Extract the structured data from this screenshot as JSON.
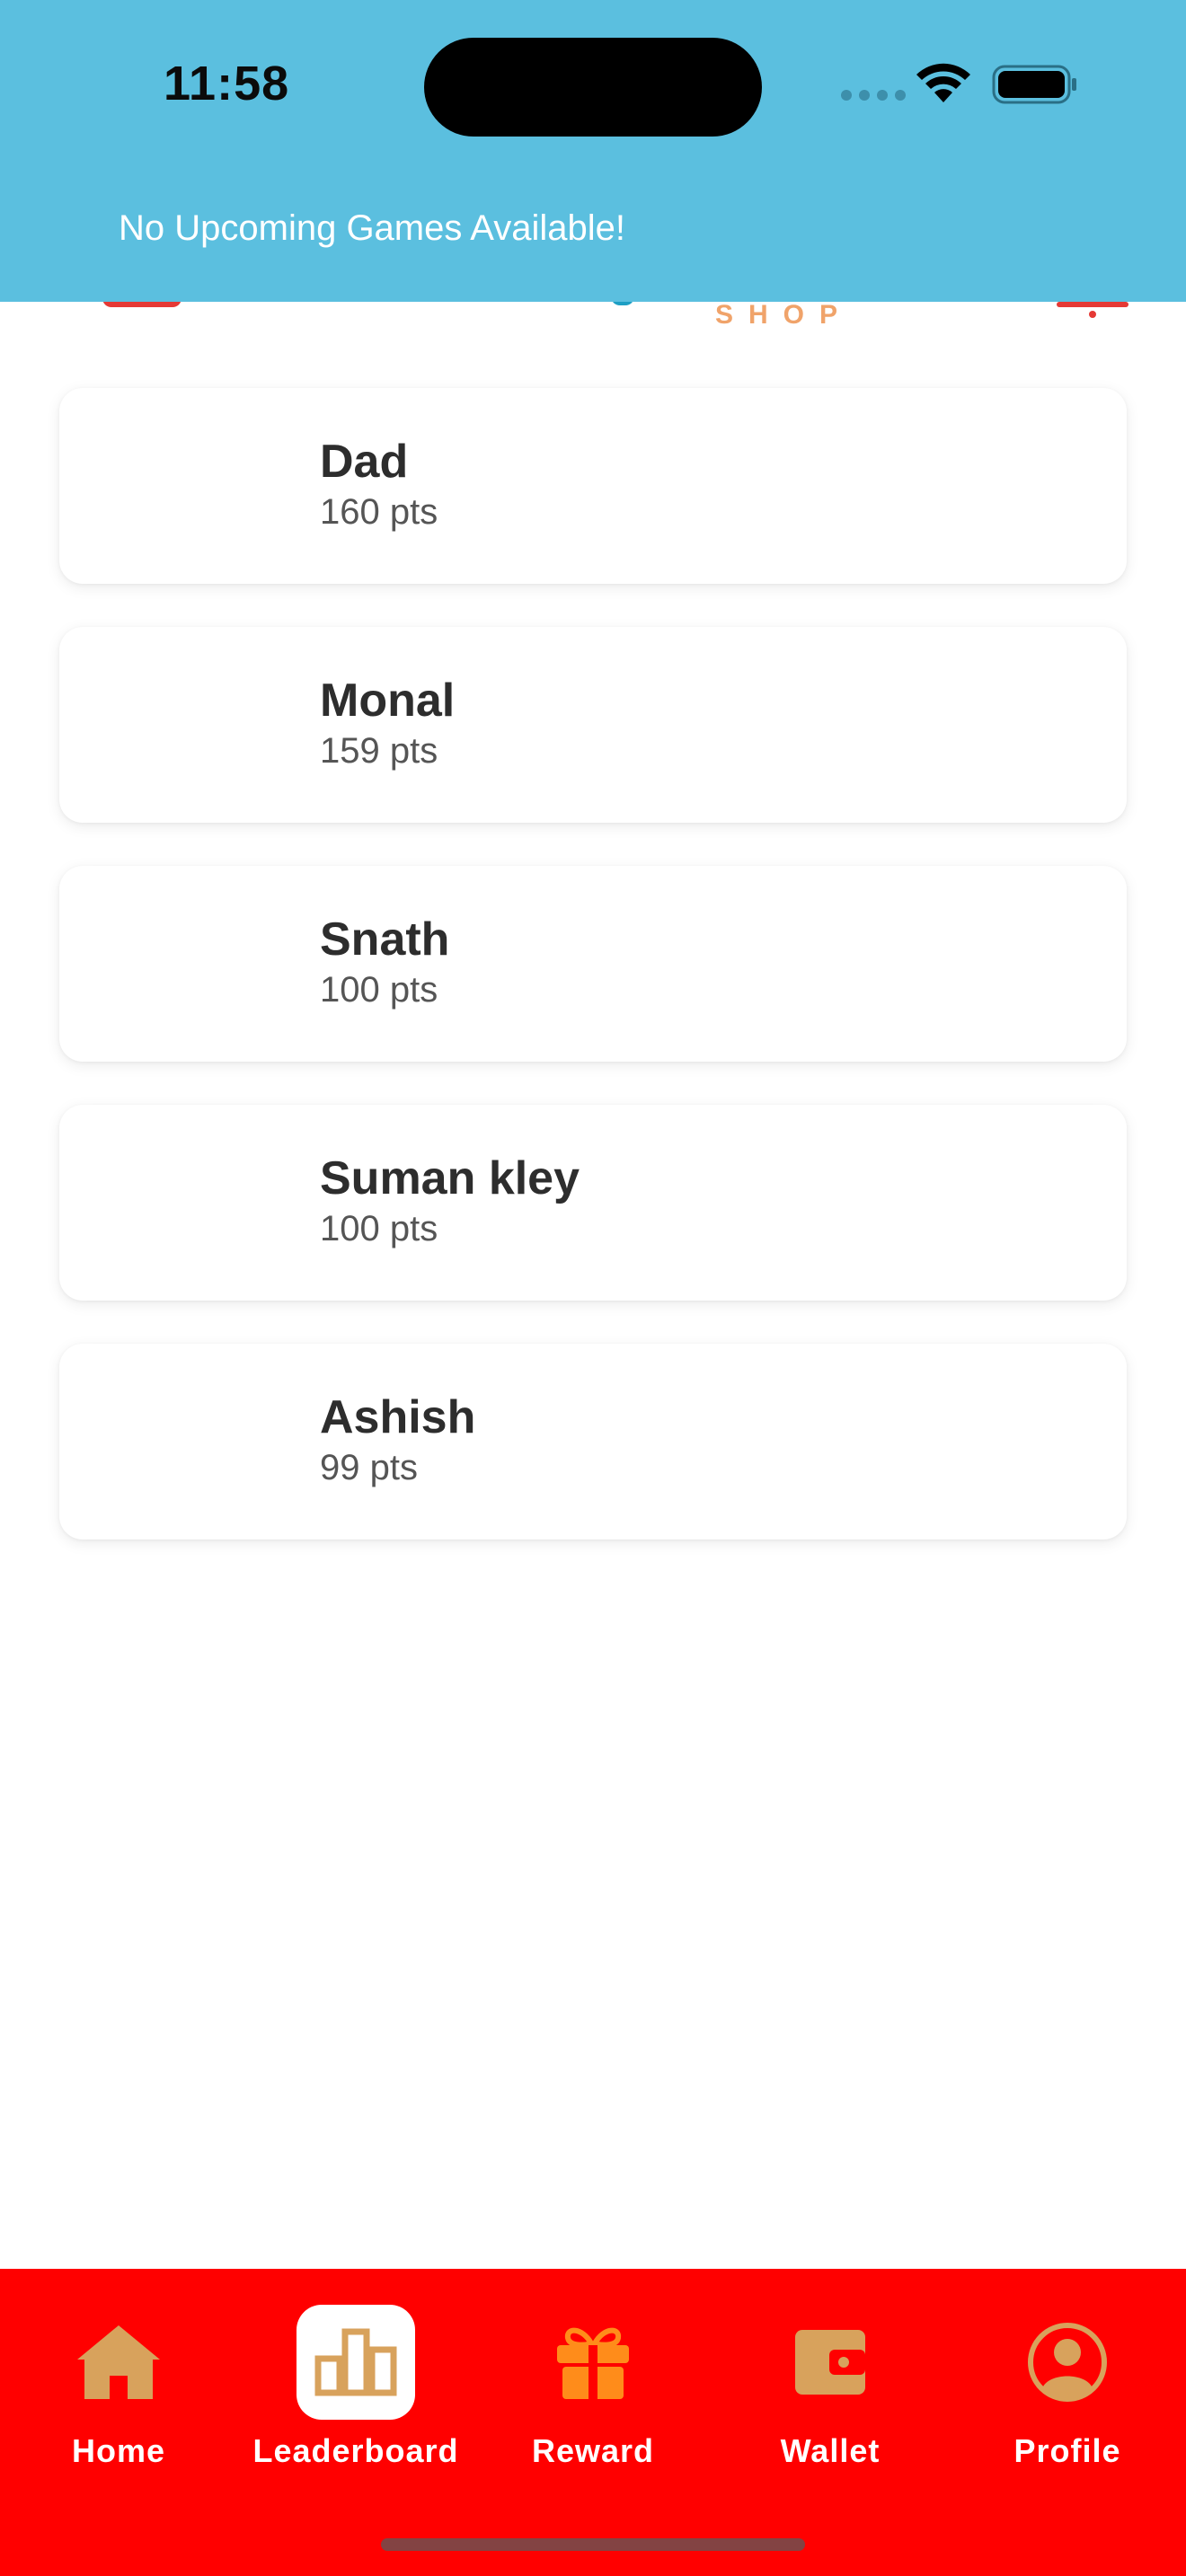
{
  "status_bar": {
    "time": "11:58"
  },
  "banner": {
    "message": "No Upcoming Games Available!"
  },
  "header": {
    "shop_word": "SHOP"
  },
  "leaderboard": {
    "players": [
      {
        "name": "Dad",
        "points": "160 pts"
      },
      {
        "name": "Monal",
        "points": "159 pts"
      },
      {
        "name": "Snath",
        "points": "100 pts"
      },
      {
        "name": "Suman kley",
        "points": "100 pts"
      },
      {
        "name": "Ashish",
        "points": "99 pts"
      }
    ]
  },
  "nav": {
    "items": [
      {
        "label": "Home",
        "icon": "home-icon"
      },
      {
        "label": "Leaderboard",
        "icon": "leaderboard-icon",
        "active": true
      },
      {
        "label": "Reward",
        "icon": "gift-icon"
      },
      {
        "label": "Wallet",
        "icon": "wallet-icon"
      },
      {
        "label": "Profile",
        "icon": "profile-icon"
      }
    ]
  },
  "colors": {
    "banner": "#5bbfdf",
    "nav_background": "#ff0000",
    "icon_tan": "#d8a25c",
    "icon_orange": "#ff8c1a"
  }
}
